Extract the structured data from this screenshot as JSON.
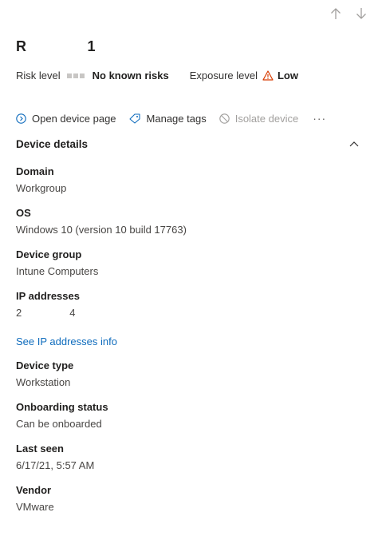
{
  "nav": {
    "up_icon": "arrow-up-icon",
    "down_icon": "arrow-down-icon"
  },
  "device": {
    "name_start": "R",
    "name_end": "1"
  },
  "risk": {
    "label": "Risk level",
    "value": "No known risks",
    "bar_color": "#c8c6c4"
  },
  "exposure": {
    "label": "Exposure level",
    "value": "Low",
    "icon": "warning-icon",
    "icon_color": "#d83b01"
  },
  "actions": {
    "open_device_page": "Open device page",
    "manage_tags": "Manage tags",
    "isolate_device": "Isolate device",
    "more": "···"
  },
  "section": {
    "title": "Device details",
    "expanded": true
  },
  "details": {
    "domain_label": "Domain",
    "domain_value": "Workgroup",
    "os_label": "OS",
    "os_value": "Windows 10 (version 10 build 17763)",
    "device_group_label": "Device group",
    "device_group_value": "Intune Computers",
    "ip_label": "IP addresses",
    "ip_value_start": "2",
    "ip_value_end": "4",
    "ip_link": "See IP addresses info",
    "device_type_label": "Device type",
    "device_type_value": "Workstation",
    "onboarding_label": "Onboarding status",
    "onboarding_value": "Can be onboarded",
    "last_seen_label": "Last seen",
    "last_seen_value": "6/17/21, 5:57 AM",
    "vendor_label": "Vendor",
    "vendor_value": "VMware"
  },
  "colors": {
    "link": "#0f6cbd",
    "accent": "#0f6cbd"
  }
}
